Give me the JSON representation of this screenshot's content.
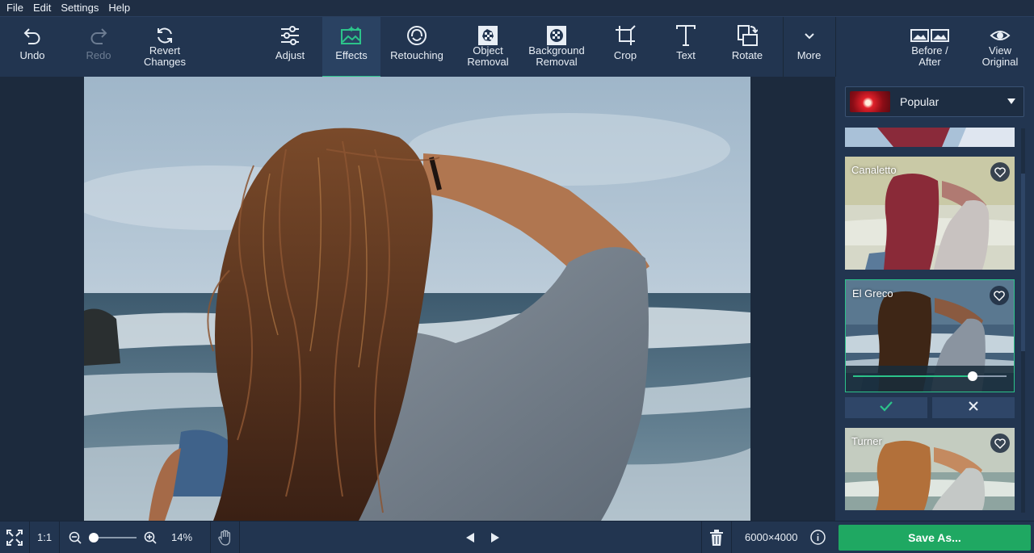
{
  "menu": [
    "File",
    "Edit",
    "Settings",
    "Help"
  ],
  "toolbar": {
    "undo": "Undo",
    "redo": "Redo",
    "revert": "Revert\nChanges",
    "adjust": "Adjust",
    "effects": "Effects",
    "retouching": "Retouching",
    "object_removal": "Object\nRemoval",
    "background_removal": "Background\nRemoval",
    "crop": "Crop",
    "text": "Text",
    "rotate": "Rotate",
    "more": "More",
    "before_after": "Before /\nAfter",
    "view_original": "View\nOriginal"
  },
  "panel": {
    "category": "Popular",
    "effects": [
      {
        "name": "Canaletto"
      },
      {
        "name": "El Greco",
        "intensity": 0.78
      },
      {
        "name": "Turner"
      }
    ],
    "icons": {
      "apply": "check-icon",
      "cancel": "close-icon",
      "favorite": "heart-icon"
    }
  },
  "bottom": {
    "ratio": "1:1",
    "zoom": "14%",
    "zoom_level": 0.05,
    "dimensions": "6000×4000"
  },
  "save_label": "Save As...",
  "colors": {
    "accent": "#2cc38a",
    "save": "#1fa862",
    "toolbar": "#223550",
    "background": "#1c2a3d"
  }
}
